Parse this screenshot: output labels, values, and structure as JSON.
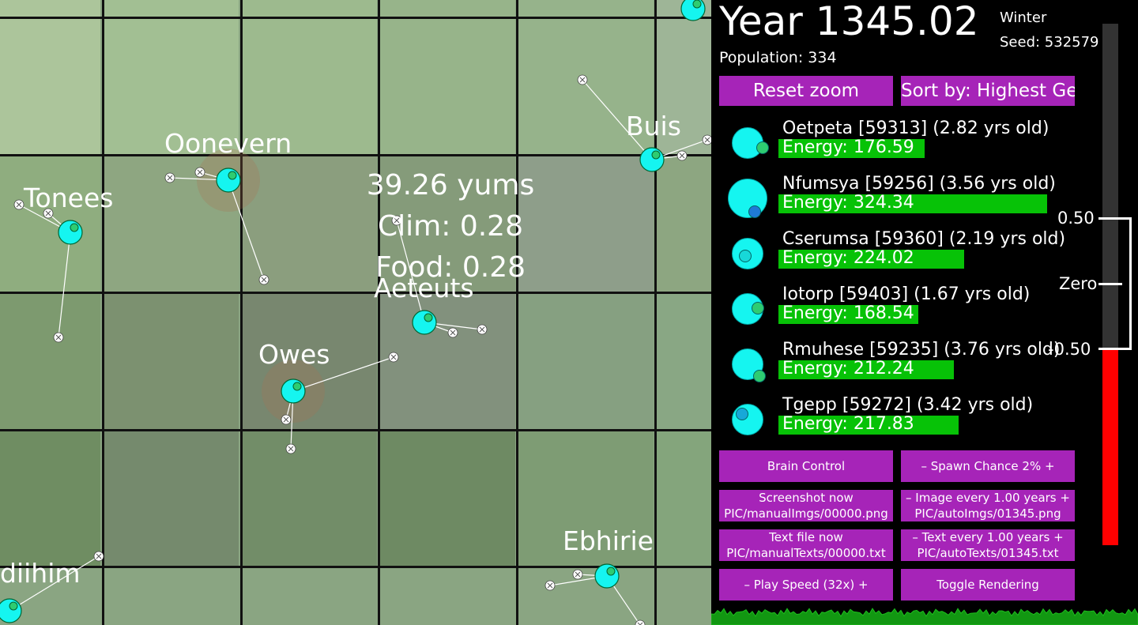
{
  "header": {
    "year": "Year 1345.02",
    "season": "Winter",
    "seed": "Seed: 532579",
    "population": "Population: 334"
  },
  "controls": {
    "reset_zoom": "Reset zoom",
    "sort_by": "Sort by: Highest Gen"
  },
  "creature_list": [
    {
      "label": "Oetpeta [59313] (2.82 yrs old)",
      "energy_label": "Energy: 176.59",
      "energy": 176.59
    },
    {
      "label": "Nfumsya [59256] (3.56 yrs old)",
      "energy_label": "Energy: 324.34",
      "energy": 324.34
    },
    {
      "label": "Cserumsa [59360] (2.19 yrs old)",
      "energy_label": "Energy: 224.02",
      "energy": 224.02
    },
    {
      "label": "Iotorp [59403] (1.67 yrs old)",
      "energy_label": "Energy: 168.54",
      "energy": 168.54
    },
    {
      "label": "Rmuhese [59235] (3.76 yrs old)",
      "energy_label": "Energy: 212.24",
      "energy": 212.24
    },
    {
      "label": "Tgepp [59272] (3.42 yrs old)",
      "energy_label": "Energy: 217.83",
      "energy": 217.83
    }
  ],
  "buttons": {
    "brain_control": "Brain Control",
    "spawn_chance": "–   Spawn Chance 2%   +",
    "screenshot_now": "Screenshot now",
    "screenshot_path": "PIC/manualImgs/00000.png",
    "image_every": "–   Image every 1.00 years   +",
    "image_path": "PIC/autoImgs/01345.png",
    "text_file_now": "Text file now",
    "text_file_path": "PIC/manualTexts/00000.txt",
    "text_every": "–   Text every 1.00 years   +",
    "text_path": "PIC/autoTexts/01345.txt",
    "play_speed": "–    Play Speed (32x)    +",
    "toggle_rendering": "Toggle Rendering"
  },
  "meter": {
    "top_label": "0.50",
    "mid_label": "Zero",
    "bottom_label": "-0.50",
    "value_fraction": 0.61
  },
  "tile_info": {
    "yums": "39.26 yums",
    "clim": "Clim: 0.28",
    "food": "Food: 0.28"
  },
  "world_creatures": [
    "Oonevern",
    "Tonees",
    "Buis",
    "Aeteuts",
    "Owes",
    "Ebhirie",
    "diihim"
  ],
  "colors": {
    "button": "#a624b8",
    "energy": "#07c207",
    "creature": "#15f5f0",
    "meter_negative": "#ff0000",
    "meter_track": "#333333"
  }
}
